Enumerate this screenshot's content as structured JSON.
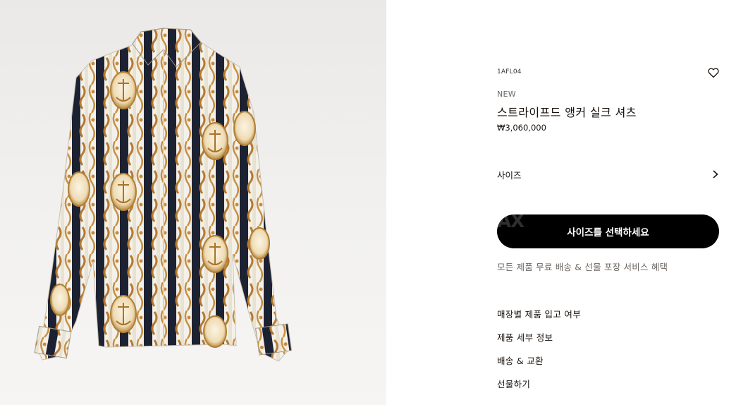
{
  "product": {
    "sku": "1AFL04",
    "badge": "NEW",
    "name": "스트라이프드 앵커 실크 셔츠",
    "price": "₩3,060,000",
    "image_description_icon": "silk-shirt-image"
  },
  "size": {
    "label": "사이즈",
    "icon": "chevron-right-icon"
  },
  "cta": {
    "label": "사이즈를 선택하세요",
    "watermark": "AX"
  },
  "benefit": "모든 제품 무료 배송 & 선물 포장 서비스 혜택",
  "links": [
    {
      "label": "매장별 제품 입고 여부"
    },
    {
      "label": "제품 세부 정보"
    },
    {
      "label": "배송 & 교환"
    },
    {
      "label": "선물하기"
    }
  ],
  "icons": {
    "wishlist": "heart-icon"
  },
  "colors": {
    "accent": "#000000",
    "text": "#19110b",
    "muted": "#6d6661",
    "image_bg": "#f0efed"
  }
}
